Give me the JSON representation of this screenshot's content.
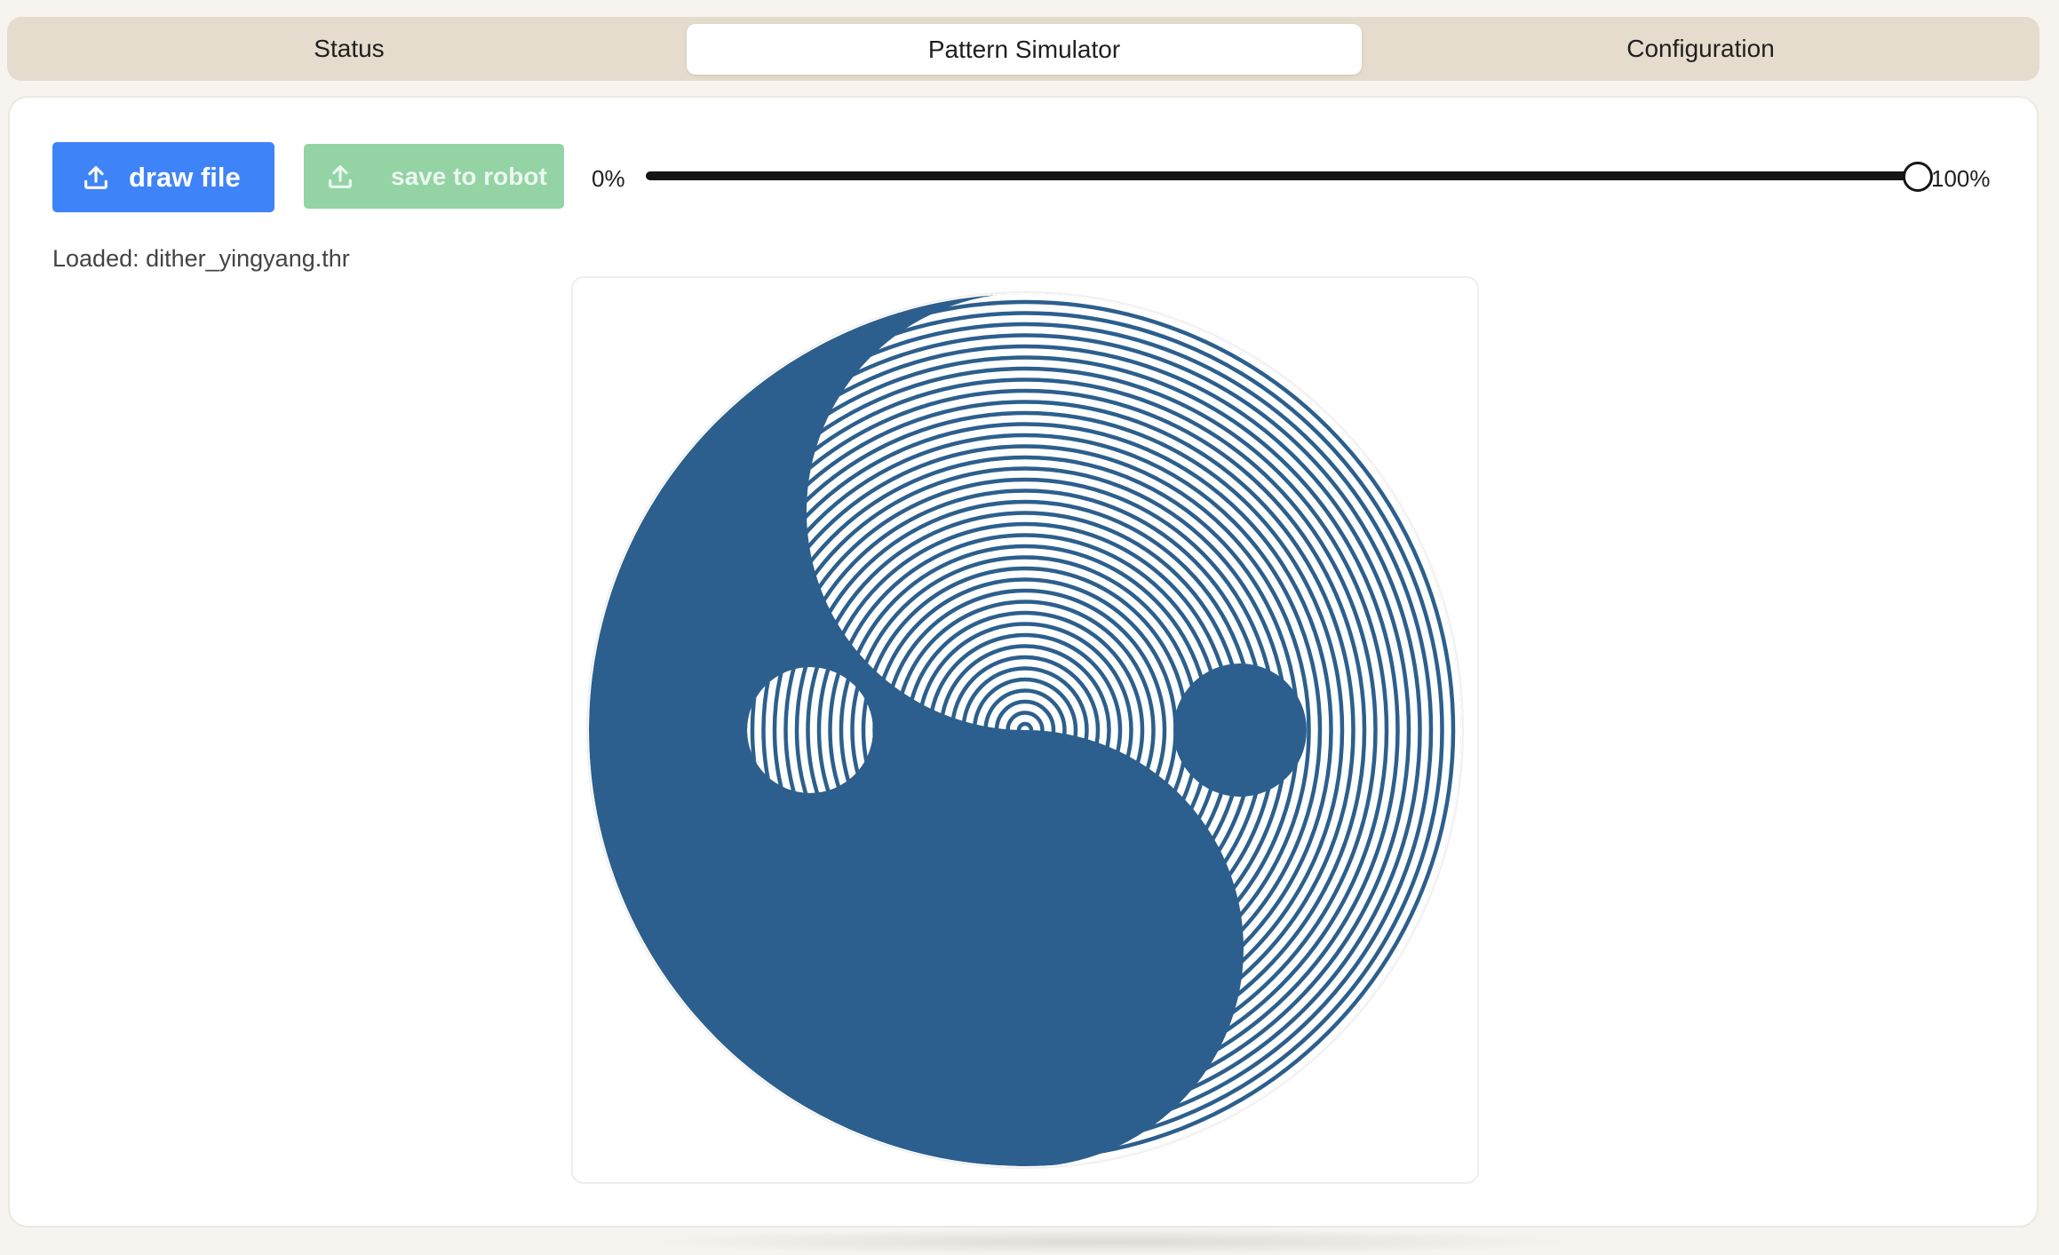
{
  "tabs": [
    {
      "label": "Status"
    },
    {
      "label": "Pattern Simulator"
    },
    {
      "label": "Configuration"
    }
  ],
  "active_tab": "Pattern Simulator",
  "toolbar": {
    "draw_label": "draw file",
    "save_label": "save to robot",
    "draw_icon": "upload-icon",
    "save_icon": "upload-icon"
  },
  "progress": {
    "min_label": "0%",
    "max_label": "100%",
    "value_percent": 100
  },
  "loaded_text": "Loaded: dither_yingyang.thr",
  "colors": {
    "pattern": "#2c5f8d",
    "draw_button": "#3f83f8",
    "save_button": "#93d3a4",
    "tab_bar": "#e6dccd",
    "slider": "#151515"
  }
}
